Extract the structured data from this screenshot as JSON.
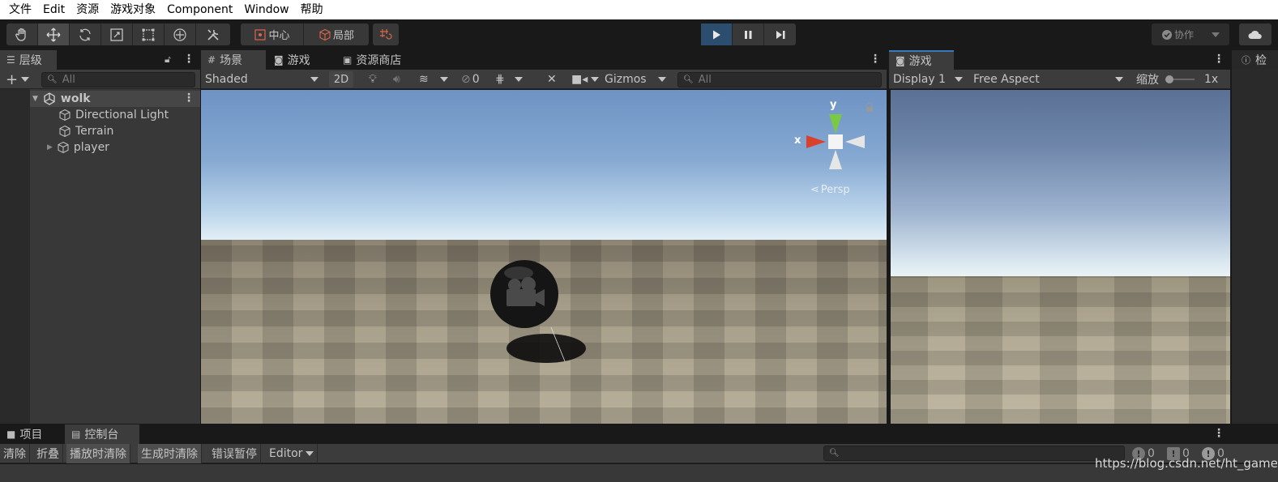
{
  "menu": [
    "文件",
    "Edit",
    "资源",
    "游戏对象",
    "Component",
    "Window",
    "帮助"
  ],
  "toolbar": {
    "tools": [
      "hand-tool",
      "move-tool",
      "rotate-tool",
      "scale-tool",
      "rect-tool",
      "transform-tool",
      "custom-tool"
    ],
    "pivot_label": "中心",
    "space_label": "局部",
    "collab_label": "协作"
  },
  "hierarchy": {
    "tab_label": "层级",
    "search_placeholder": "All",
    "scene_name": "wolk",
    "items": [
      "Directional Light",
      "Terrain",
      "player"
    ]
  },
  "scene": {
    "tabs": [
      "场景",
      "游戏",
      "资源商店"
    ],
    "shading_mode": "Shaded",
    "mode_2d": "2D",
    "hidden_count": "0",
    "gizmos_label": "Gizmos",
    "search_placeholder": "All",
    "gizmo_axis_y": "y",
    "gizmo_axis_x": "x",
    "projection_label": "Persp"
  },
  "game": {
    "tab_label": "游戏",
    "display": "Display 1",
    "aspect": "Free Aspect",
    "scale_label": "缩放",
    "scale_value": "1x"
  },
  "inspector": {
    "tab_label": "检"
  },
  "bottom": {
    "tabs": [
      "项目",
      "控制台"
    ],
    "console_buttons": [
      "清除",
      "折叠",
      "播放时清除",
      "生成时清除",
      "错误暂停",
      "Editor"
    ],
    "log_count": "0",
    "warning_count": "0",
    "error_count": "0"
  },
  "watermark": "https://blog.csdn.net/ht_game",
  "colors": {
    "accent_blue": "#3a79bb",
    "play_active": "#2b4e6f",
    "panel_bg": "#383838",
    "toolbar_bg": "#3c3c3c"
  }
}
